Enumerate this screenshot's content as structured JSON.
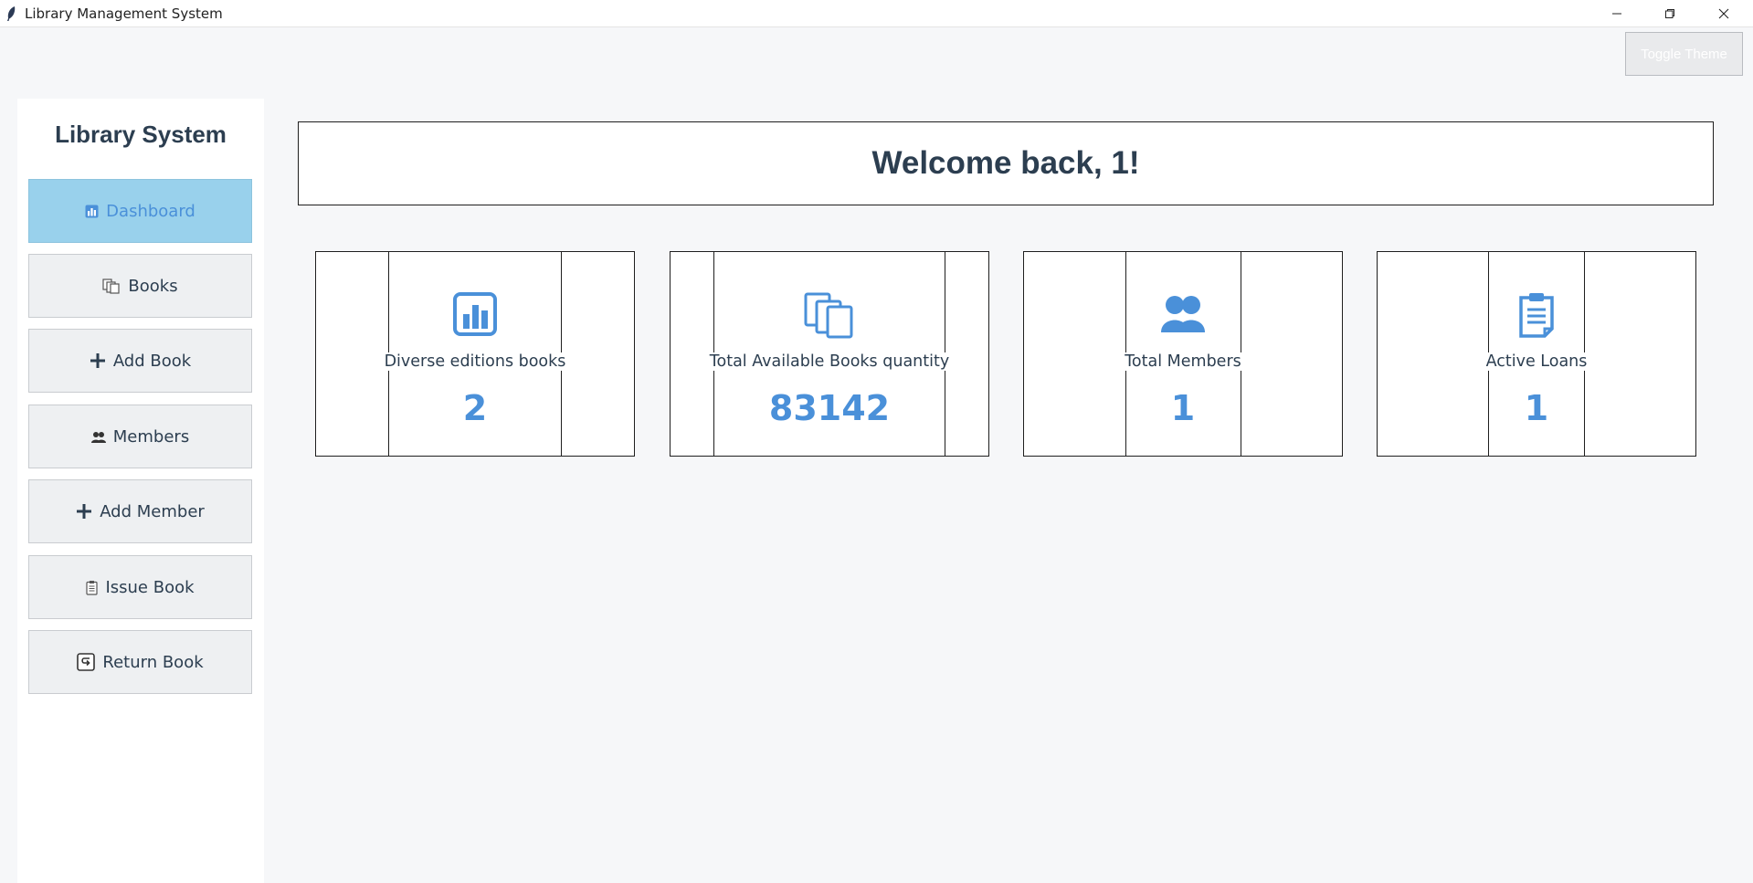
{
  "window": {
    "title": "Library Management System",
    "icon": "feather-icon",
    "controls": [
      "minimize-icon",
      "restore-icon",
      "close-icon"
    ]
  },
  "toggle_theme": {
    "label": "Toggle Theme"
  },
  "sidebar": {
    "title": "Library System",
    "items": [
      {
        "label": "Dashboard",
        "icon": "bar-chart-icon",
        "active": true
      },
      {
        "label": "Books",
        "icon": "books-icon",
        "active": false
      },
      {
        "label": "Add Book",
        "icon": "plus-icon",
        "active": false
      },
      {
        "label": "Members",
        "icon": "members-icon",
        "active": false
      },
      {
        "label": "Add Member",
        "icon": "plus-icon",
        "active": false
      },
      {
        "label": "Issue Book",
        "icon": "clipboard-icon",
        "active": false
      },
      {
        "label": "Return Book",
        "icon": "return-icon",
        "active": false
      }
    ]
  },
  "welcome": {
    "text": "Welcome back, 1!"
  },
  "stats": [
    {
      "label": "Diverse editions books",
      "value": "2",
      "icon": "bar-chart-icon"
    },
    {
      "label": "Total Available Books quantity",
      "value": "83142",
      "icon": "books-icon"
    },
    {
      "label": "Total Members",
      "value": "1",
      "icon": "members-icon"
    },
    {
      "label": "Active Loans",
      "value": "1",
      "icon": "clipboard-icon"
    }
  ],
  "colors": {
    "accent": "#4a90d9",
    "active_nav_bg": "#99d1ec",
    "text": "#2c3e50",
    "background": "#f6f7f9"
  }
}
